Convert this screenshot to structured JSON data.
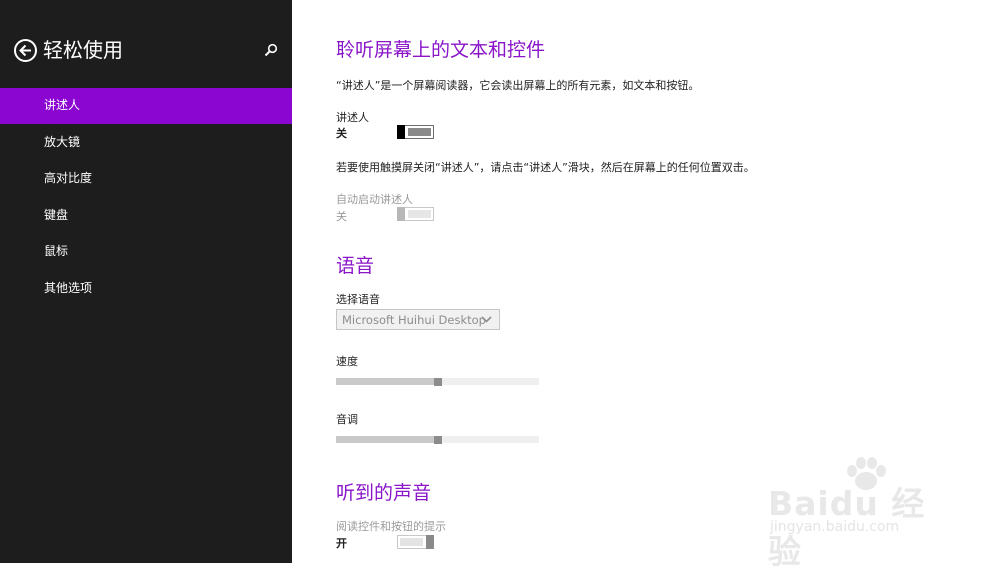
{
  "sidebar": {
    "title": "轻松使用",
    "items": [
      {
        "label": "讲述人",
        "active": true
      },
      {
        "label": "放大镜"
      },
      {
        "label": "高对比度"
      },
      {
        "label": "键盘"
      },
      {
        "label": "鼠标"
      },
      {
        "label": "其他选项"
      }
    ]
  },
  "section1": {
    "heading": "聆听屏幕上的文本和控件",
    "description": "“讲述人”是一个屏幕阅读器，它会读出屏幕上的所有元素，如文本和按钮。",
    "narrator_label": "讲述人",
    "narrator_state": "关",
    "touch_hint": "若要使用触摸屏关闭“讲述人”，请点击“讲述人”滑块，然后在屏幕上的任何位置双击。",
    "autostart_label": "自动启动讲述人",
    "autostart_state": "关"
  },
  "section2": {
    "heading": "语音",
    "voice_label": "选择语音",
    "voice_value": "Microsoft Huihui Desktop",
    "speed_label": "速度",
    "speed_level": 0.5,
    "pitch_label": "音调",
    "pitch_level": 0.5
  },
  "section3": {
    "heading": "听到的声音",
    "hints_label": "阅读控件和按钮的提示",
    "hints_state": "开"
  },
  "watermark": {
    "brand": "Baidu 经验",
    "url": "jingyan.baidu.com"
  },
  "colors": {
    "accent": "#8b06d1",
    "heading": "#8a15c9",
    "sidebar_bg": "#1d1d1d"
  }
}
